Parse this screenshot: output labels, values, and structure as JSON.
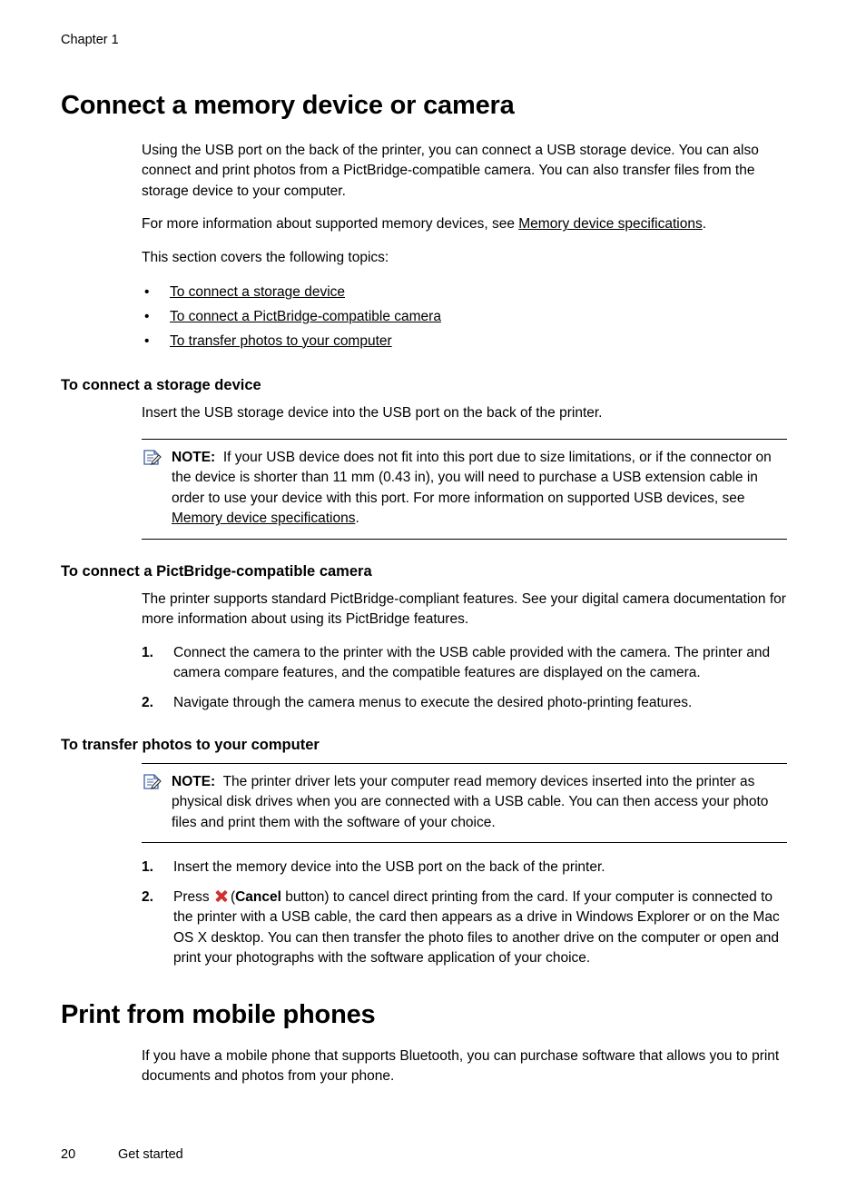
{
  "header": {
    "chapter": "Chapter 1"
  },
  "section1": {
    "title": "Connect a memory device or camera",
    "para1": "Using the USB port on the back of the printer, you can connect a USB storage device. You can also connect and print photos from a PictBridge-compatible camera. You can also transfer files from the storage device to your computer.",
    "para2_prefix": "For more information about supported memory devices, see ",
    "para2_link": "Memory device specifications",
    "para2_suffix": ".",
    "para3": "This section covers the following topics:",
    "topics": [
      "To connect a storage device",
      "To connect a PictBridge-compatible camera",
      "To transfer photos to your computer"
    ],
    "bullet_char": "•"
  },
  "subsection1": {
    "heading": "To connect a storage device",
    "para1": "Insert the USB storage device into the USB port on the back of the printer.",
    "note": {
      "label": "NOTE:",
      "text_before_link": "If your USB device does not fit into this port due to size limitations, or if the connector on the device is shorter than 11 mm (0.43 in), you will need to purchase a USB extension cable in order to use your device with this port. For more information on supported USB devices, see ",
      "link": "Memory device specifications",
      "text_after_link": "."
    }
  },
  "subsection2": {
    "heading": "To connect a PictBridge-compatible camera",
    "para1": "The printer supports standard PictBridge-compliant features. See your digital camera documentation for more information about using its PictBridge features.",
    "steps": [
      {
        "num": "1.",
        "text": "Connect the camera to the printer with the USB cable provided with the camera. The printer and camera compare features, and the compatible features are displayed on the camera."
      },
      {
        "num": "2.",
        "text": "Navigate through the camera menus to execute the desired photo-printing features."
      }
    ]
  },
  "subsection3": {
    "heading": "To transfer photos to your computer",
    "note": {
      "label": "NOTE:",
      "text": "The printer driver lets your computer read memory devices inserted into the printer as physical disk drives when you are connected with a USB cable. You can then access your photo files and print them with the software of your choice."
    },
    "step1": {
      "num": "1.",
      "text": "Insert the memory device into the USB port on the back of the printer."
    },
    "step2": {
      "num": "2.",
      "text_before_icon": "Press ",
      "icon_name": "cancel-icon",
      "text_open_paren": "(",
      "bold_label": "Cancel",
      "text_after_bold": " button) to cancel direct printing from the card. If your computer is connected to the printer with a USB cable, the card then appears as a drive in Windows Explorer or on the Mac OS X desktop. You can then transfer the photo files to another drive on the computer or open and print your photographs with the software application of your choice."
    }
  },
  "section2": {
    "title": "Print from mobile phones",
    "para1": "If you have a mobile phone that supports Bluetooth, you can purchase software that allows you to print documents and photos from your phone."
  },
  "footer": {
    "page_number": "20",
    "section_name": "Get started"
  },
  "colors": {
    "cancel_icon": "#d23030",
    "text": "#000000",
    "background": "#ffffff"
  }
}
